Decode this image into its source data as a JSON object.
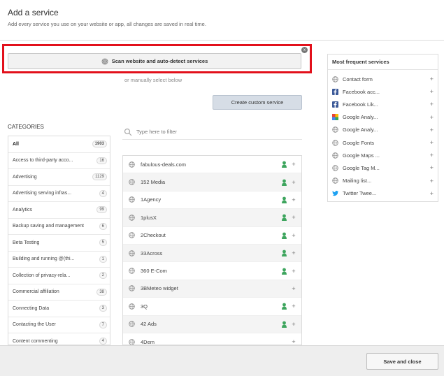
{
  "header": {
    "title": "Add a service",
    "subtitle": "Add every service you use on your website or app, all changes are saved in real time."
  },
  "scan": {
    "button_label": "Scan website and auto-detect services",
    "badge": "x",
    "manual_text": "or manually select below"
  },
  "custom_button_label": "Create custom service",
  "categories_label": "CATEGORIES",
  "filter": {
    "placeholder": "Type here to filter"
  },
  "categories": [
    {
      "label": "All",
      "count": "1903"
    },
    {
      "label": "Access to third-party acco...",
      "count": "16"
    },
    {
      "label": "Advertising",
      "count": "1129"
    },
    {
      "label": "Advertising serving infras...",
      "count": "4"
    },
    {
      "label": "Analytics",
      "count": "99"
    },
    {
      "label": "Backup saving and management",
      "count": "6"
    },
    {
      "label": "Beta Testing",
      "count": "5"
    },
    {
      "label": "Building and running @(thi...",
      "count": "1"
    },
    {
      "label": "Collection of privacy-rela...",
      "count": "2"
    },
    {
      "label": "Commercial affiliation",
      "count": "38"
    },
    {
      "label": "Connecting Data",
      "count": "3"
    },
    {
      "label": "Contacting the User",
      "count": "7"
    },
    {
      "label": "Content commenting",
      "count": "4"
    }
  ],
  "services": [
    {
      "name": "fabulous-deals.com",
      "person": true
    },
    {
      "name": "152 Media",
      "person": true
    },
    {
      "name": "1Agency",
      "person": true
    },
    {
      "name": "1plusX",
      "person": true
    },
    {
      "name": "2Checkout",
      "person": true
    },
    {
      "name": "33Across",
      "person": true
    },
    {
      "name": "360 E-Com",
      "person": true
    },
    {
      "name": "3BMeteo widget",
      "person": false
    },
    {
      "name": "3Q",
      "person": true
    },
    {
      "name": "42 Ads",
      "person": true
    },
    {
      "name": "4Dem",
      "person": false
    }
  ],
  "frequent": {
    "title": "Most frequent services",
    "items": [
      {
        "label": "Contact form",
        "icon": "globe-icon"
      },
      {
        "label": "Facebook acc...",
        "icon": "facebook-icon"
      },
      {
        "label": "Facebook Lik...",
        "icon": "facebook-icon"
      },
      {
        "label": "Google Analy...",
        "icon": "google-icon"
      },
      {
        "label": "Google Analy...",
        "icon": "globe-icon"
      },
      {
        "label": "Google Fonts",
        "icon": "globe-icon"
      },
      {
        "label": "Google Maps ...",
        "icon": "globe-icon"
      },
      {
        "label": "Google Tag M...",
        "icon": "globe-icon"
      },
      {
        "label": "Mailing list...",
        "icon": "globe-icon"
      },
      {
        "label": "Twitter Twee...",
        "icon": "twitter-icon"
      }
    ]
  },
  "footer": {
    "save_label": "Save and close"
  },
  "colors": {
    "highlight": "#e2101b",
    "person_icon": "#3ea55e",
    "facebook": "#3b5998",
    "twitter": "#1da1f2",
    "custom_button": "#d6dde6"
  }
}
